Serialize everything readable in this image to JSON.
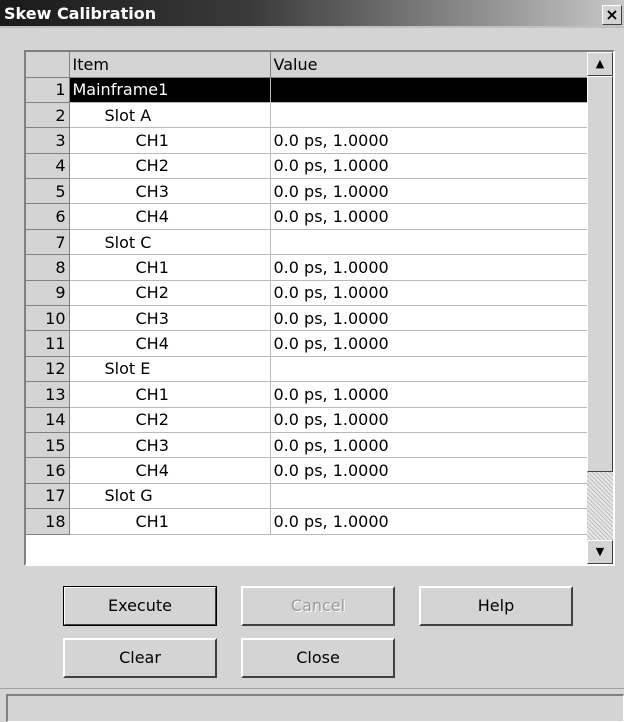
{
  "window": {
    "title": "Skew Calibration",
    "close_label": "×"
  },
  "grid": {
    "columns": [
      "",
      "Item",
      "Value"
    ],
    "rows": [
      {
        "num": "1",
        "item": "Mainframe1",
        "value": "",
        "level": 0,
        "selected": true
      },
      {
        "num": "2",
        "item": "Slot A",
        "value": "",
        "level": 1
      },
      {
        "num": "3",
        "item": "CH1",
        "value": "0.0 ps, 1.0000",
        "level": 2
      },
      {
        "num": "4",
        "item": "CH2",
        "value": "0.0 ps, 1.0000",
        "level": 2
      },
      {
        "num": "5",
        "item": "CH3",
        "value": "0.0 ps, 1.0000",
        "level": 2
      },
      {
        "num": "6",
        "item": "CH4",
        "value": "0.0 ps, 1.0000",
        "level": 2
      },
      {
        "num": "7",
        "item": "Slot C",
        "value": "",
        "level": 1
      },
      {
        "num": "8",
        "item": "CH1",
        "value": "0.0 ps, 1.0000",
        "level": 2
      },
      {
        "num": "9",
        "item": "CH2",
        "value": "0.0 ps, 1.0000",
        "level": 2
      },
      {
        "num": "10",
        "item": "CH3",
        "value": "0.0 ps, 1.0000",
        "level": 2
      },
      {
        "num": "11",
        "item": "CH4",
        "value": "0.0 ps, 1.0000",
        "level": 2
      },
      {
        "num": "12",
        "item": "Slot E",
        "value": "",
        "level": 1
      },
      {
        "num": "13",
        "item": "CH1",
        "value": "0.0 ps, 1.0000",
        "level": 2
      },
      {
        "num": "14",
        "item": "CH2",
        "value": "0.0 ps, 1.0000",
        "level": 2
      },
      {
        "num": "15",
        "item": "CH3",
        "value": "0.0 ps, 1.0000",
        "level": 2
      },
      {
        "num": "16",
        "item": "CH4",
        "value": "0.0 ps, 1.0000",
        "level": 2
      },
      {
        "num": "17",
        "item": "Slot G",
        "value": "",
        "level": 1
      },
      {
        "num": "18",
        "item": "CH1",
        "value": "0.0 ps, 1.0000",
        "level": 2
      }
    ]
  },
  "scrollbar": {
    "up_icon": "scroll-up-arrow-icon",
    "down_icon": "scroll-down-arrow-icon",
    "up_glyph": "▲",
    "down_glyph": "▼"
  },
  "buttons": {
    "execute": "Execute",
    "cancel": "Cancel",
    "help": "Help",
    "clear": "Clear",
    "close": "Close"
  },
  "statusbar": {
    "text": ""
  }
}
